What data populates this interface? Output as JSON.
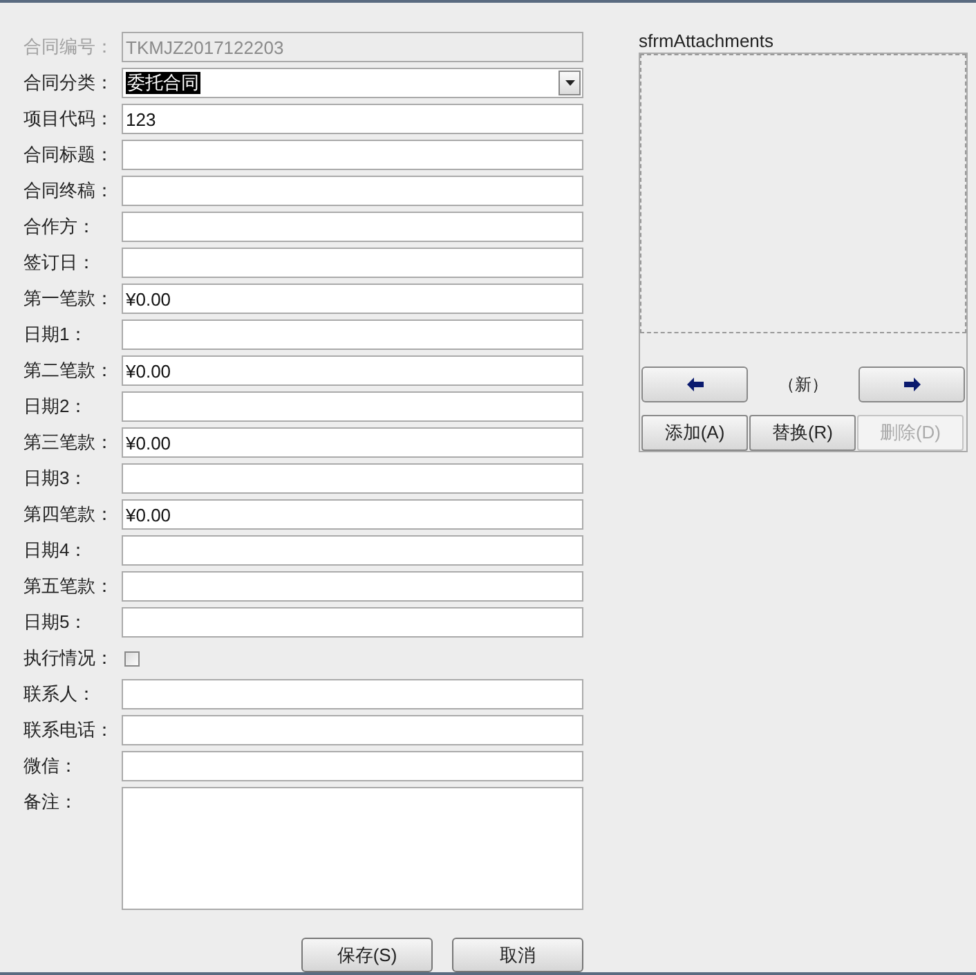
{
  "form": {
    "fields": [
      {
        "kind": "text",
        "label": "合同编号：",
        "value": "TKMJZ2017122203",
        "disabled": true
      },
      {
        "kind": "combo",
        "label": "合同分类：",
        "value": "委托合同",
        "disabled": false
      },
      {
        "kind": "text",
        "label": "项目代码：",
        "value": "123",
        "disabled": false
      },
      {
        "kind": "text",
        "label": "合同标题：",
        "disabled": false
      },
      {
        "kind": "text",
        "label": "合同终稿：",
        "disabled": false
      },
      {
        "kind": "text",
        "label": "合作方：",
        "disabled": false
      },
      {
        "kind": "text",
        "label": "签订日：",
        "disabled": false
      },
      {
        "kind": "text",
        "label": "第一笔款：",
        "value": "¥0.00",
        "disabled": false
      },
      {
        "kind": "text",
        "label": "日期1：",
        "disabled": false
      },
      {
        "kind": "text",
        "label": "第二笔款：",
        "value": "¥0.00",
        "disabled": false
      },
      {
        "kind": "text",
        "label": "日期2：",
        "disabled": false
      },
      {
        "kind": "text",
        "label": "第三笔款：",
        "value": "¥0.00",
        "disabled": false
      },
      {
        "kind": "text",
        "label": "日期3：",
        "disabled": false
      },
      {
        "kind": "text",
        "label": "第四笔款：",
        "value": "¥0.00",
        "disabled": false
      },
      {
        "kind": "text",
        "label": "日期4：",
        "disabled": false
      },
      {
        "kind": "text",
        "label": "第五笔款：",
        "disabled": false
      },
      {
        "kind": "text",
        "label": "日期5：",
        "disabled": false
      },
      {
        "kind": "checkbox",
        "label": "执行情况：",
        "checked": false,
        "disabled": false
      },
      {
        "kind": "text",
        "label": "联系人：",
        "disabled": false
      },
      {
        "kind": "text",
        "label": "联系电话：",
        "disabled": false
      },
      {
        "kind": "text",
        "label": "微信：",
        "disabled": false
      },
      {
        "kind": "memo",
        "label": "备注：",
        "disabled": false
      }
    ],
    "buttons": [
      "保存(S)",
      "取消"
    ]
  },
  "attachments": {
    "title": "sfrmAttachments",
    "record": "（新）",
    "actions": [
      {
        "label": "添加(A)",
        "disabled": false
      },
      {
        "label": "替换(R)",
        "disabled": false
      },
      {
        "label": "删除(D)",
        "disabled": true
      }
    ]
  }
}
